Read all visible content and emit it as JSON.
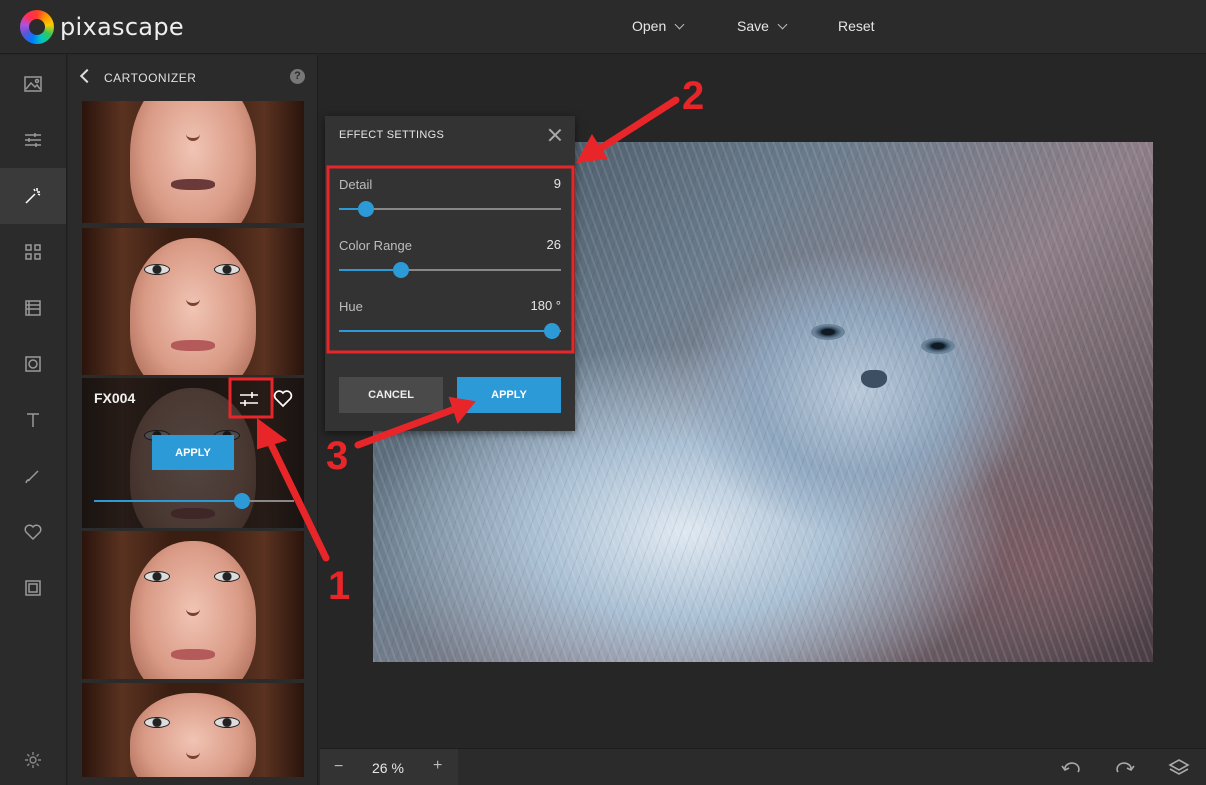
{
  "app": {
    "logo_text": "pixascape",
    "menu": {
      "open_label": "Open",
      "save_label": "Save",
      "reset_label": "Reset"
    }
  },
  "tools": [
    {
      "icon": "image-icon",
      "active": false
    },
    {
      "icon": "sliders-icon",
      "active": false
    },
    {
      "icon": "magic-wand-icon",
      "active": true
    },
    {
      "icon": "grid-icon",
      "active": false
    },
    {
      "icon": "texture-icon",
      "active": false
    },
    {
      "icon": "vignette-icon",
      "active": false
    },
    {
      "icon": "text-icon",
      "active": false
    },
    {
      "icon": "brush-icon",
      "active": false
    },
    {
      "icon": "heart-icon",
      "active": false
    },
    {
      "icon": "frame-icon",
      "active": false
    }
  ],
  "panel": {
    "title": "CARTOONIZER",
    "help_icon": "?",
    "active_effect": {
      "label": "FX004",
      "apply_label": "APPLY",
      "intensity": 0.74
    }
  },
  "dialog": {
    "title": "EFFECT SETTINGS",
    "params": [
      {
        "label": "Detail",
        "value": "9",
        "level": 0.12
      },
      {
        "label": "Color Range",
        "value": "26",
        "level": 0.28
      },
      {
        "label": "Hue",
        "value": "180 °",
        "level": 0.96
      }
    ],
    "cancel_label": "CANCEL",
    "apply_label": "APPLY"
  },
  "bottom": {
    "zoom_out": "−",
    "zoom_value": "26 %",
    "zoom_in": "+"
  },
  "annotations": {
    "step1": "1",
    "step2": "2",
    "step3": "3",
    "color": "#e8262a"
  },
  "colors": {
    "accent": "#2d9ad8",
    "background": "#262626",
    "panel": "#2b2b2b"
  }
}
